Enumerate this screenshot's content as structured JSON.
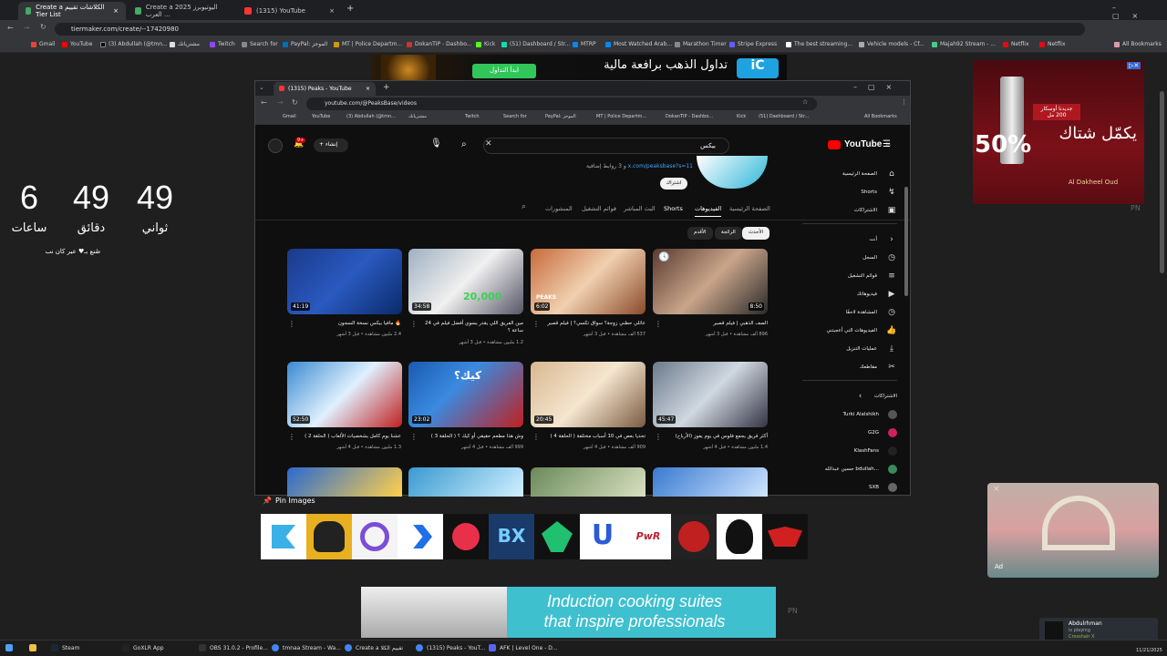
{
  "outer_browser": {
    "tabs": [
      "Create a الكلاشات تقييم Tier List",
      "Create a 2025 اليوتيوبرز العرب ...",
      "(1315) YouTube"
    ],
    "url": "tiermaker.com/create/--17420980",
    "bookmarks": [
      "Gmail",
      "YouTube",
      "(3) Abdullah (@tmn...",
      "مشترياتك",
      "Twitch",
      "Search for",
      "PayPal: الموجز",
      "MT | Police Departm...",
      "DokanTIP - Dashbo...",
      "Kick",
      "(51) Dashboard / Str...",
      "MTRP",
      "Most Watched Arab...",
      "Marathon Timer",
      "Stripe Express",
      "The best streaming...",
      "Vehicle models - Cf...",
      "Majah92 Stream - ...",
      "Netflix",
      "Netflix",
      "All Bookmarks"
    ]
  },
  "countdown": {
    "hours": "6",
    "hours_label": "ساعات",
    "minutes": "49",
    "minutes_label": "دقائق",
    "seconds": "49",
    "seconds_label": "ثواني",
    "credit": "صُنع بـ♥ عبر كان نب"
  },
  "ads": {
    "top_banner": "تداول الذهب برافعة مالية",
    "top_banner_cta": "ابدأ التداول",
    "right_ad_badge": "جديدنا أوسكار 200 مل",
    "right_ad_percent": "50%",
    "right_ad_text": "يكمّل شتاك",
    "right_ad_brand": "Al Dakheel Oud",
    "pn": "PN",
    "bottom_line1": "Induction cooking suites",
    "bottom_line2": "that inspire professionals",
    "pn2": "PN"
  },
  "inner_browser": {
    "tab": "(1315) Peaks - YouTube",
    "url": "youtube.com/@PeaksBase/videos",
    "bookmarks": [
      "Gmail",
      "YouTube",
      "(3) Abdullah (@tmn...",
      "مشترياتك",
      "Twitch",
      "Search for",
      "PayPal: الموجز",
      "MT | Police Departm...",
      "DokanTIP - Dashbo...",
      "Kick",
      "(51) Dashboard / Str...",
      "All Bookmarks"
    ]
  },
  "youtube": {
    "logo": "YouTube",
    "logo_sup": "SA",
    "search_value": "بيكس",
    "create_label": "إنشاء",
    "notif_count": "9+",
    "channel_link": "x.com/peaksbase?s=11",
    "channel_more": "و 3 روابط إضافية",
    "subscribe": "اشتراك",
    "tabs": [
      "الصفحة الرئيسية",
      "الفيديوهات",
      "Shorts",
      "البث المباشر",
      "قوائم التشغيل",
      "المنشورات"
    ],
    "chips": [
      "الأحدث",
      "الرائجة",
      "الأقدم"
    ],
    "sidebar_main": [
      "الصفحة الرئيسية",
      "Shorts",
      "الاشتراكات"
    ],
    "you_header": "أنت",
    "sidebar_you": [
      "السجل",
      "قوائم التشغيل",
      "فيديوهاتك",
      "المشاهدة لاحقًا",
      "الفيديوهات التي أعجبتني",
      "عمليات التنزيل",
      "مقاطعك"
    ],
    "subs_header": "الاشتراكات",
    "subs": [
      "Turki Alalshikh",
      "G2G",
      "KlashFans",
      "حسين عبدالله bdullah...",
      "SXB"
    ],
    "videos": [
      {
        "title": "الصف الذهبي | فيلم قصير",
        "meta": "896 ألف مشاهدة • قبل 3 أشهر",
        "dur": "8:50"
      },
      {
        "title": "عائلي حطني زوجة؟ سواق تكسي؟ | فيلم قصير",
        "meta": "537 ألف مشاهدة • قبل 3 أشهر",
        "dur": "6:02"
      },
      {
        "title": "مين الفريق اللي يقدر يسوي أفضل فيلم في 24 ساعة ؟",
        "meta": "1.2 مليون مشاهدة • قبل 3 أشهر",
        "dur": "34:58"
      },
      {
        "title": "🔥 مافيا بيكس نسخة السجون",
        "meta": "2.4 مليون مشاهدة • قبل 3 أشهر",
        "dur": "41:19"
      },
      {
        "title": "أكثر فريق يجمع فلوس في يوم يفوز (الأرباح)",
        "meta": "1.4 مليون مشاهدة • قبل 4 أشهر",
        "dur": "45:47"
      },
      {
        "title": "تحديا بعض في 10 أسباب مختلفة ( الحلقة 4 )",
        "meta": "909 ألف مشاهدة • قبل 4 أشهر",
        "dur": "20:45"
      },
      {
        "title": "وش هذا مطعم حقيقي أو كيك ؟ ( الحلقة 3 )",
        "meta": "999 ألف مشاهدة • قبل 4 أشهر",
        "dur": "23:02"
      },
      {
        "title": "عشنا يوم كامل بشخصيات الألعاب ( الحلقة 2 )",
        "meta": "1.3 مليون مشاهدة • قبل 4 أشهر",
        "dur": "52:50"
      }
    ],
    "thumb_text_20000": "20,000",
    "thumb_text_peaks": "PEAKS",
    "thumb_text_cake": "كيك؟"
  },
  "pin_images": {
    "label": "Pin Images"
  },
  "notification": {
    "name": "Abdulrhman",
    "line1": "is playing",
    "line2": "Crosshair X"
  },
  "ad_small": "Ad",
  "taskbar": {
    "items": [
      "Steam",
      "GoXLR App",
      "OBS 31.0.2 - Profile...",
      "tmnaa Stream - Wa...",
      "Create a تقييم الكلا",
      "(1315) Peaks - YouT...",
      "AFK | Level One - D..."
    ],
    "date": "11/21/2025"
  }
}
